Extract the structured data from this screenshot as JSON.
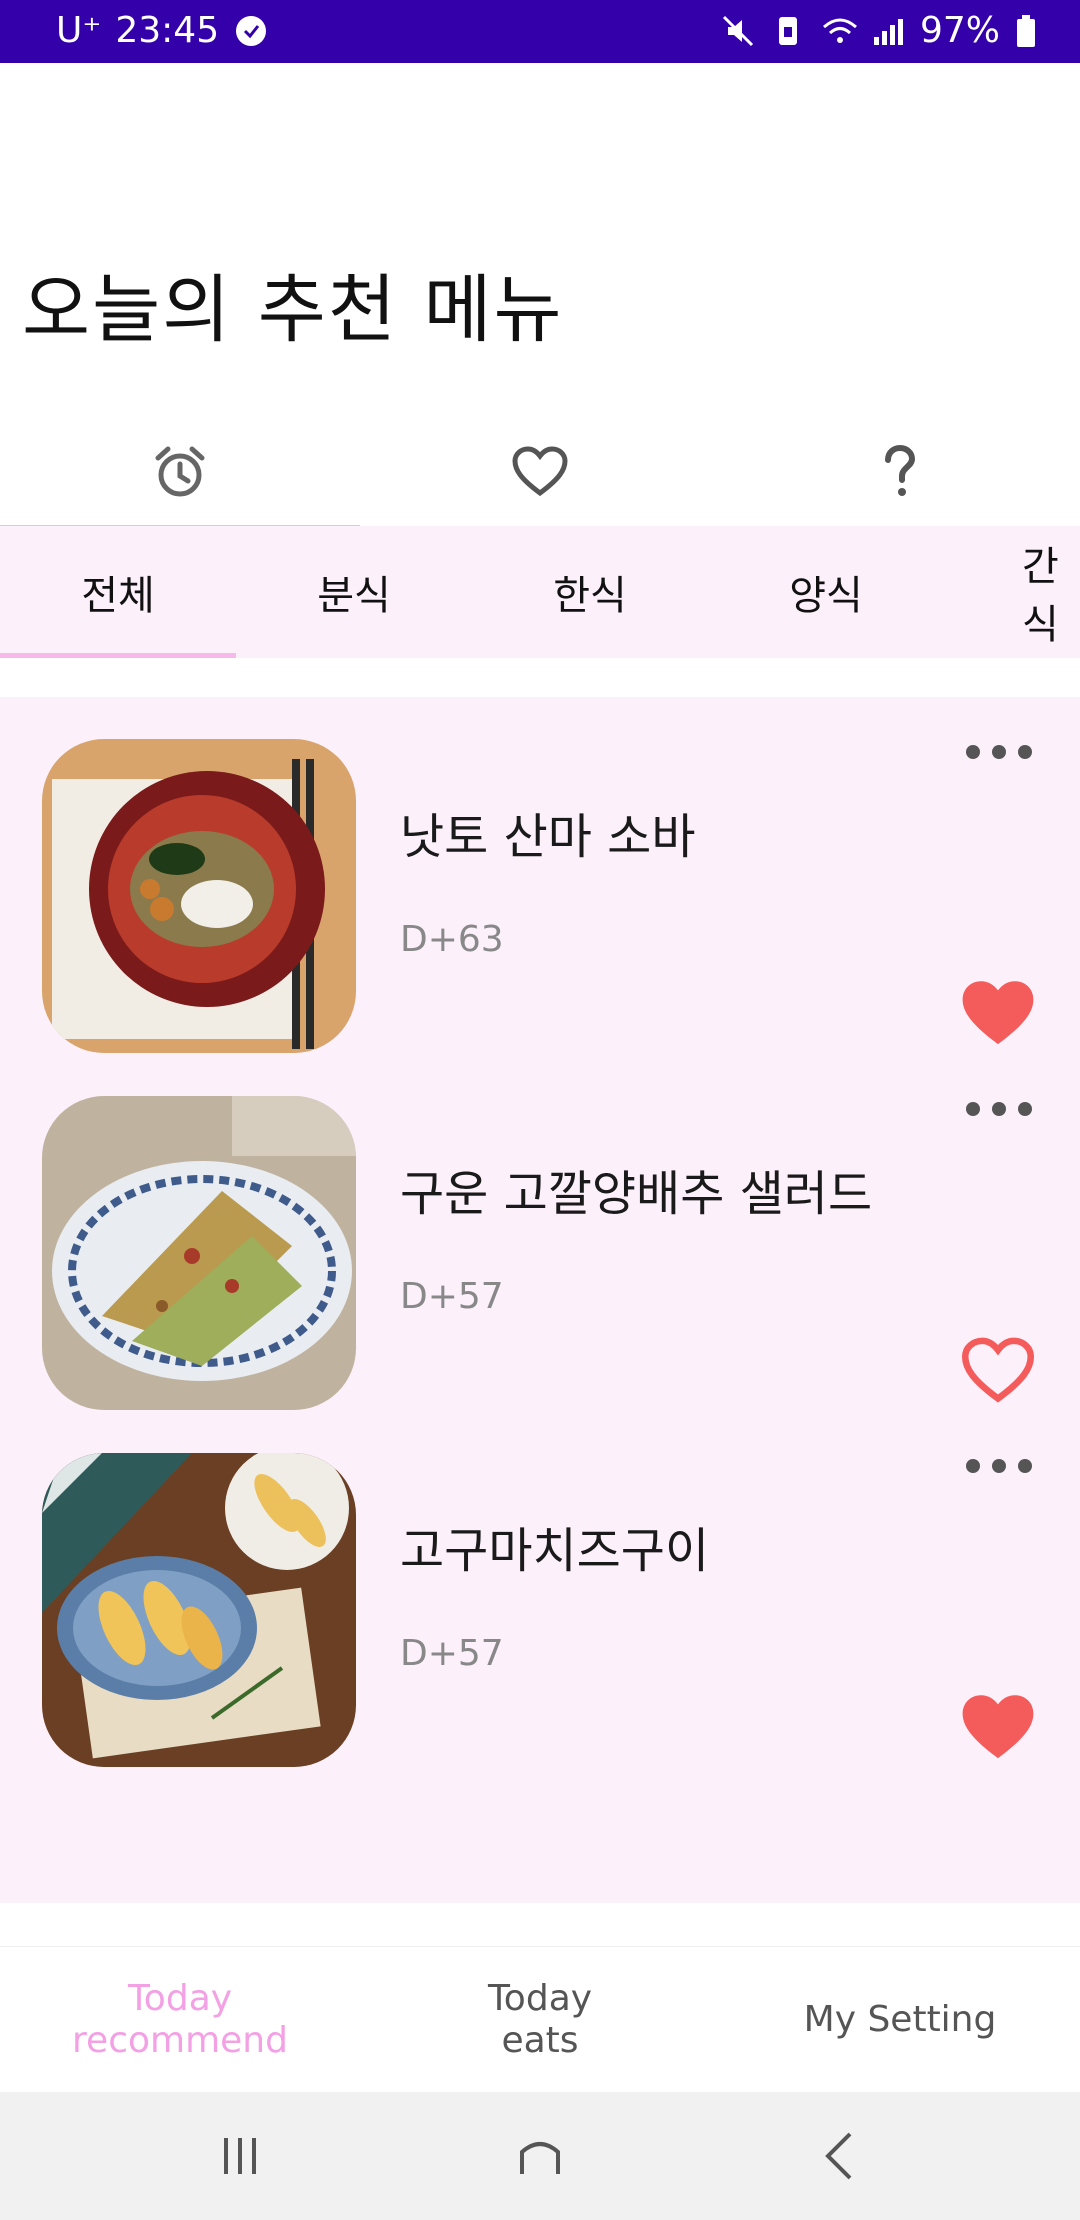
{
  "status_bar": {
    "carrier": "U⁺",
    "time": "23:45",
    "battery": "97%",
    "background": "#3300aa"
  },
  "page": {
    "title": "오늘의 추천 메뉴"
  },
  "top_tabs": [
    {
      "icon": "alarm-clock-icon",
      "selected": true
    },
    {
      "icon": "heart-outline-icon",
      "selected": false
    },
    {
      "icon": "question-mark-icon",
      "selected": false
    }
  ],
  "categories": [
    {
      "label": "전체",
      "selected": true
    },
    {
      "label": "분식"
    },
    {
      "label": "한식"
    },
    {
      "label": "양식"
    },
    {
      "label": "간식"
    }
  ],
  "menu_items": [
    {
      "name": "낫토 산마 소바",
      "dday": "D+63",
      "favorite": true
    },
    {
      "name": "구운 고깔양배추 샐러드",
      "dday": "D+57",
      "favorite": false
    },
    {
      "name": "고구마치즈구이",
      "dday": "D+57",
      "favorite": true
    }
  ],
  "bottom_nav": [
    {
      "label": "Today\nrecommend",
      "active": true
    },
    {
      "label": "Today\neats",
      "active": false
    },
    {
      "label": "My Setting",
      "active": false
    }
  ],
  "colors": {
    "accent_pink": "#f6b9ea",
    "heart_red": "#f45b5b",
    "list_bg": "#fcf0fb"
  }
}
